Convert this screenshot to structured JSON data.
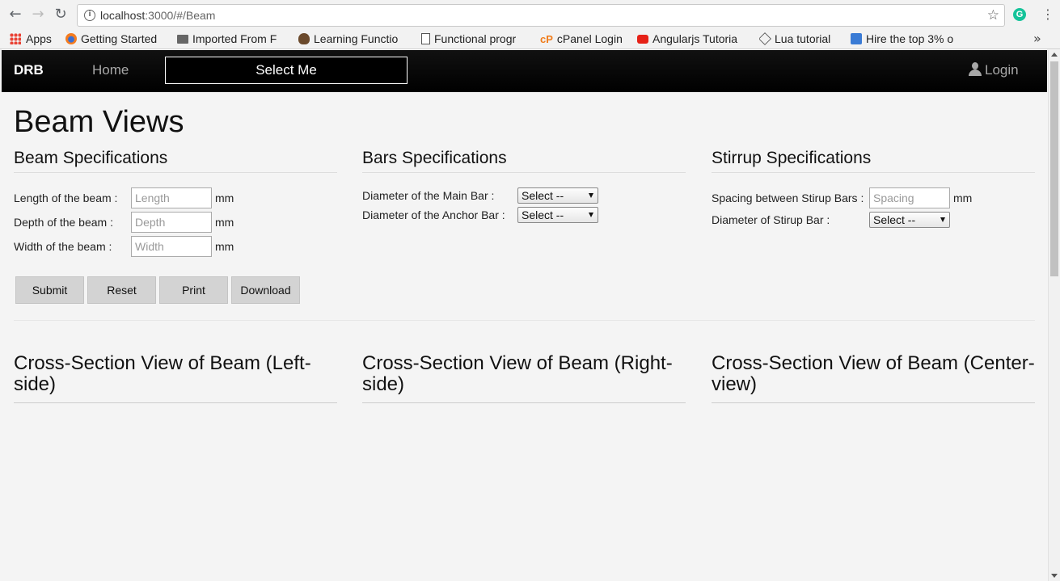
{
  "browser": {
    "url_host": "localhost",
    "url_path": ":3000/#/Beam",
    "bookmarks": [
      {
        "label": "Apps"
      },
      {
        "label": "Getting Started"
      },
      {
        "label": "Imported From F"
      },
      {
        "label": "Learning Functio"
      },
      {
        "label": "Functional progr"
      },
      {
        "label": "cPanel Login"
      },
      {
        "label": "Angularjs Tutoria"
      },
      {
        "label": "Lua tutorial"
      },
      {
        "label": "Hire the top 3% o"
      }
    ],
    "more": "»"
  },
  "nav": {
    "brand": "DRB",
    "home": "Home",
    "select": "Select Me",
    "login": "Login"
  },
  "page": {
    "title": "Beam Views",
    "beam": {
      "heading": "Beam Specifications",
      "length_label": "Length of the beam :",
      "length_placeholder": "Length",
      "depth_label": "Depth of the beam :",
      "depth_placeholder": "Depth",
      "width_label": "Width of the beam :",
      "width_placeholder": "Width",
      "unit": "mm"
    },
    "bars": {
      "heading": "Bars Specifications",
      "main_label": "Diameter of the Main Bar :",
      "main_value": "Select --",
      "anchor_label": "Diameter of the Anchor Bar :",
      "anchor_value": "Select --"
    },
    "stirrup": {
      "heading": "Stirrup Specifications",
      "spacing_label": "Spacing between Stirup Bars :",
      "spacing_placeholder": "Spacing",
      "unit": "mm",
      "diameter_label": "Diameter of Stirup Bar :",
      "diameter_value": "Select --"
    },
    "buttons": {
      "submit": "Submit",
      "reset": "Reset",
      "print": "Print",
      "download": "Download"
    },
    "views": {
      "left": "Cross-Section View of Beam (Left-side)",
      "right": "Cross-Section View of Beam (Right-side)",
      "center": "Cross-Section View of Beam (Center-view)"
    }
  }
}
